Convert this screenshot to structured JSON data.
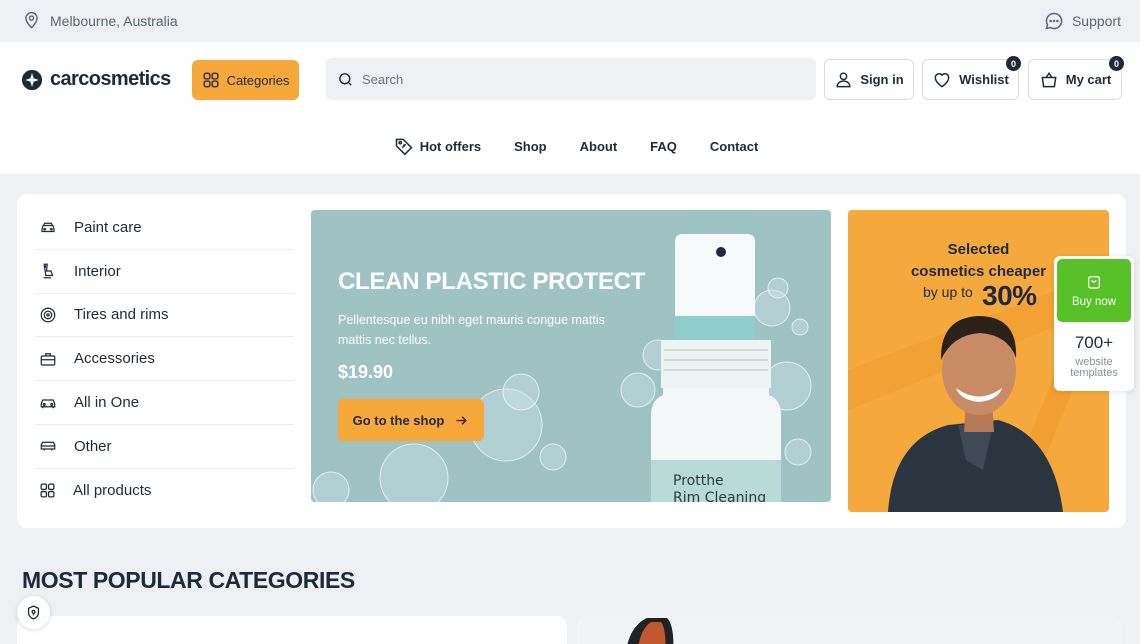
{
  "topbar": {
    "location": "Melbourne, Australia",
    "support": "Support"
  },
  "header": {
    "logo": "carcosmetics",
    "categories_label": "Categories",
    "search_placeholder": "Search",
    "signin_label": "Sign in",
    "wishlist_label": "Wishlist",
    "wishlist_count": "0",
    "cart_label": "My cart",
    "cart_count": "0"
  },
  "nav": {
    "items": [
      {
        "label": "Hot offers",
        "icon": "tag-icon"
      },
      {
        "label": "Shop"
      },
      {
        "label": "About"
      },
      {
        "label": "FAQ"
      },
      {
        "label": "Contact"
      }
    ]
  },
  "sidebar": {
    "items": [
      {
        "label": "Paint care",
        "icon": "car-icon"
      },
      {
        "label": "Interior",
        "icon": "car-seat-icon"
      },
      {
        "label": "Tires and rims",
        "icon": "tire-icon"
      },
      {
        "label": "Accessories",
        "icon": "toolbox-icon"
      },
      {
        "label": "All in One",
        "icon": "car-front-icon"
      },
      {
        "label": "Other",
        "icon": "car-other-icon"
      },
      {
        "label": "All products",
        "icon": "grid-icon"
      }
    ]
  },
  "hero": {
    "title": "CLEAN PLASTIC PROTECT",
    "text": "Pellentesque eu nibh eget mauris congue mattis mattis nec tellus.",
    "price": "$19.90",
    "button": "Go to the shop",
    "bottle_text_1": "Protthe",
    "bottle_text_2": "Rim Cleaning"
  },
  "promo": {
    "line1": "Selected",
    "line2": "cosmetics cheaper",
    "line3": "by up to",
    "percent": "30%"
  },
  "widget": {
    "buy_label": "Buy now",
    "count": "700+",
    "label": "website templates"
  },
  "section": {
    "title": "MOST POPULAR CATEGORIES"
  },
  "colors": {
    "accent": "#f7a83b",
    "dark": "#1e2a3a",
    "hero_bg": "#9fc2c2",
    "buy_green": "#58c12a"
  }
}
